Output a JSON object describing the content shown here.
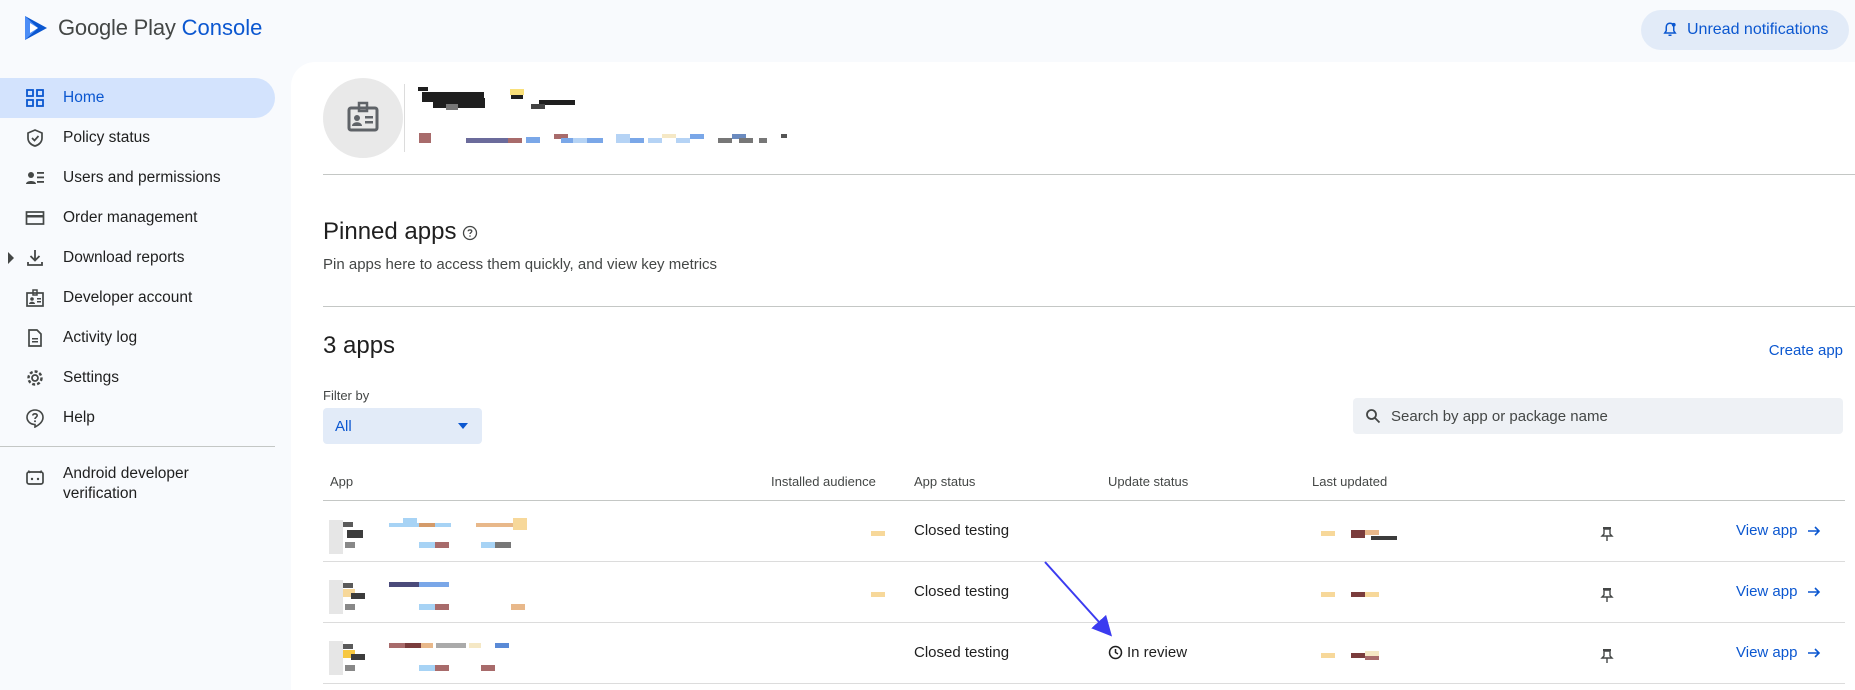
{
  "brand": {
    "google": "Google Play",
    "product": "Console",
    "logo_color": "#0b57d0"
  },
  "header": {
    "notifications_label": "Unread notifications"
  },
  "sidebar": {
    "items": [
      {
        "label": "Home",
        "icon": "grid-icon",
        "active": true
      },
      {
        "label": "Policy status",
        "icon": "shield-check-icon"
      },
      {
        "label": "Users and permissions",
        "icon": "users-icon"
      },
      {
        "label": "Order management",
        "icon": "credit-card-icon"
      },
      {
        "label": "Download reports",
        "icon": "download-icon",
        "expandable": true
      },
      {
        "label": "Developer account",
        "icon": "badge-icon"
      },
      {
        "label": "Activity log",
        "icon": "document-icon"
      },
      {
        "label": "Settings",
        "icon": "gear-icon"
      },
      {
        "label": "Help",
        "icon": "help-icon"
      }
    ],
    "verification": {
      "label": "Android developer verification",
      "icon": "android-icon"
    }
  },
  "pinned": {
    "title": "Pinned apps",
    "subtitle": "Pin apps here to access them quickly, and view key metrics"
  },
  "apps": {
    "count_label": "3 apps",
    "create_label": "Create app",
    "filter_label": "Filter by",
    "filter_value": "All",
    "search_placeholder": "Search by app or package name",
    "columns": [
      "App",
      "Installed audience",
      "App status",
      "Update status",
      "Last updated"
    ],
    "rows": [
      {
        "app_status": "Closed testing",
        "update_status": "",
        "view_label": "View app"
      },
      {
        "app_status": "Closed testing",
        "update_status": "",
        "view_label": "View app"
      },
      {
        "app_status": "Closed testing",
        "update_status": "In review",
        "view_label": "View app"
      }
    ]
  },
  "colors": {
    "accent": "#0b57d0",
    "active_bg": "#d3e3fd",
    "annotation_arrow": "#3b3bf0"
  }
}
